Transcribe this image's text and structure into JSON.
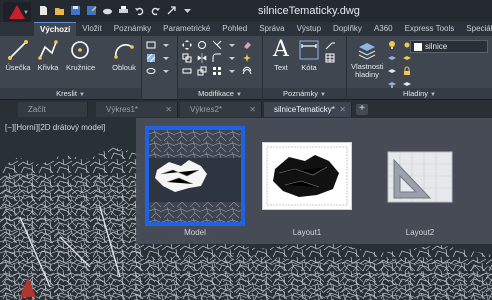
{
  "title_bar": {
    "document_title": "silniceTematicky.dwg",
    "app_logo": "autocad-a-icon"
  },
  "ribbon_tabs": [
    "Výchozí",
    "Vložit",
    "Poznámky",
    "Parametrické",
    "Pohled",
    "Správa",
    "Výstup",
    "Doplňky",
    "A360",
    "Express Tools",
    "Speciál"
  ],
  "ribbon": {
    "draw": {
      "panel_label": "Kreslit",
      "tools": [
        "Úsečka",
        "Křivka",
        "Kružnice",
        "Oblouk"
      ]
    },
    "modify": {
      "panel_label": "Modifikace"
    },
    "annotation": {
      "panel_label": "Poznámky",
      "tools": [
        "Text",
        "Kóta"
      ]
    },
    "layers": {
      "panel_label": "Hladiny",
      "properties_label": "Vlastnosti hladiny",
      "current_layer": "silnice"
    }
  },
  "file_tabs": [
    {
      "label": "Začít",
      "active": false
    },
    {
      "label": "Výkres1*",
      "active": false
    },
    {
      "label": "Výkres2*",
      "active": false
    },
    {
      "label": "silniceTematicky*",
      "active": true
    }
  ],
  "viewport": {
    "label": "[−][Horní][2D drátový model]"
  },
  "layout_preview": {
    "items": [
      {
        "label": "Model",
        "selected": true
      },
      {
        "label": "Layout1",
        "selected": false
      },
      {
        "label": "Layout2",
        "selected": false
      }
    ]
  },
  "colors": {
    "accent": "#1e63e6",
    "logo_red": "#c8202a",
    "background": "#2a3038"
  }
}
